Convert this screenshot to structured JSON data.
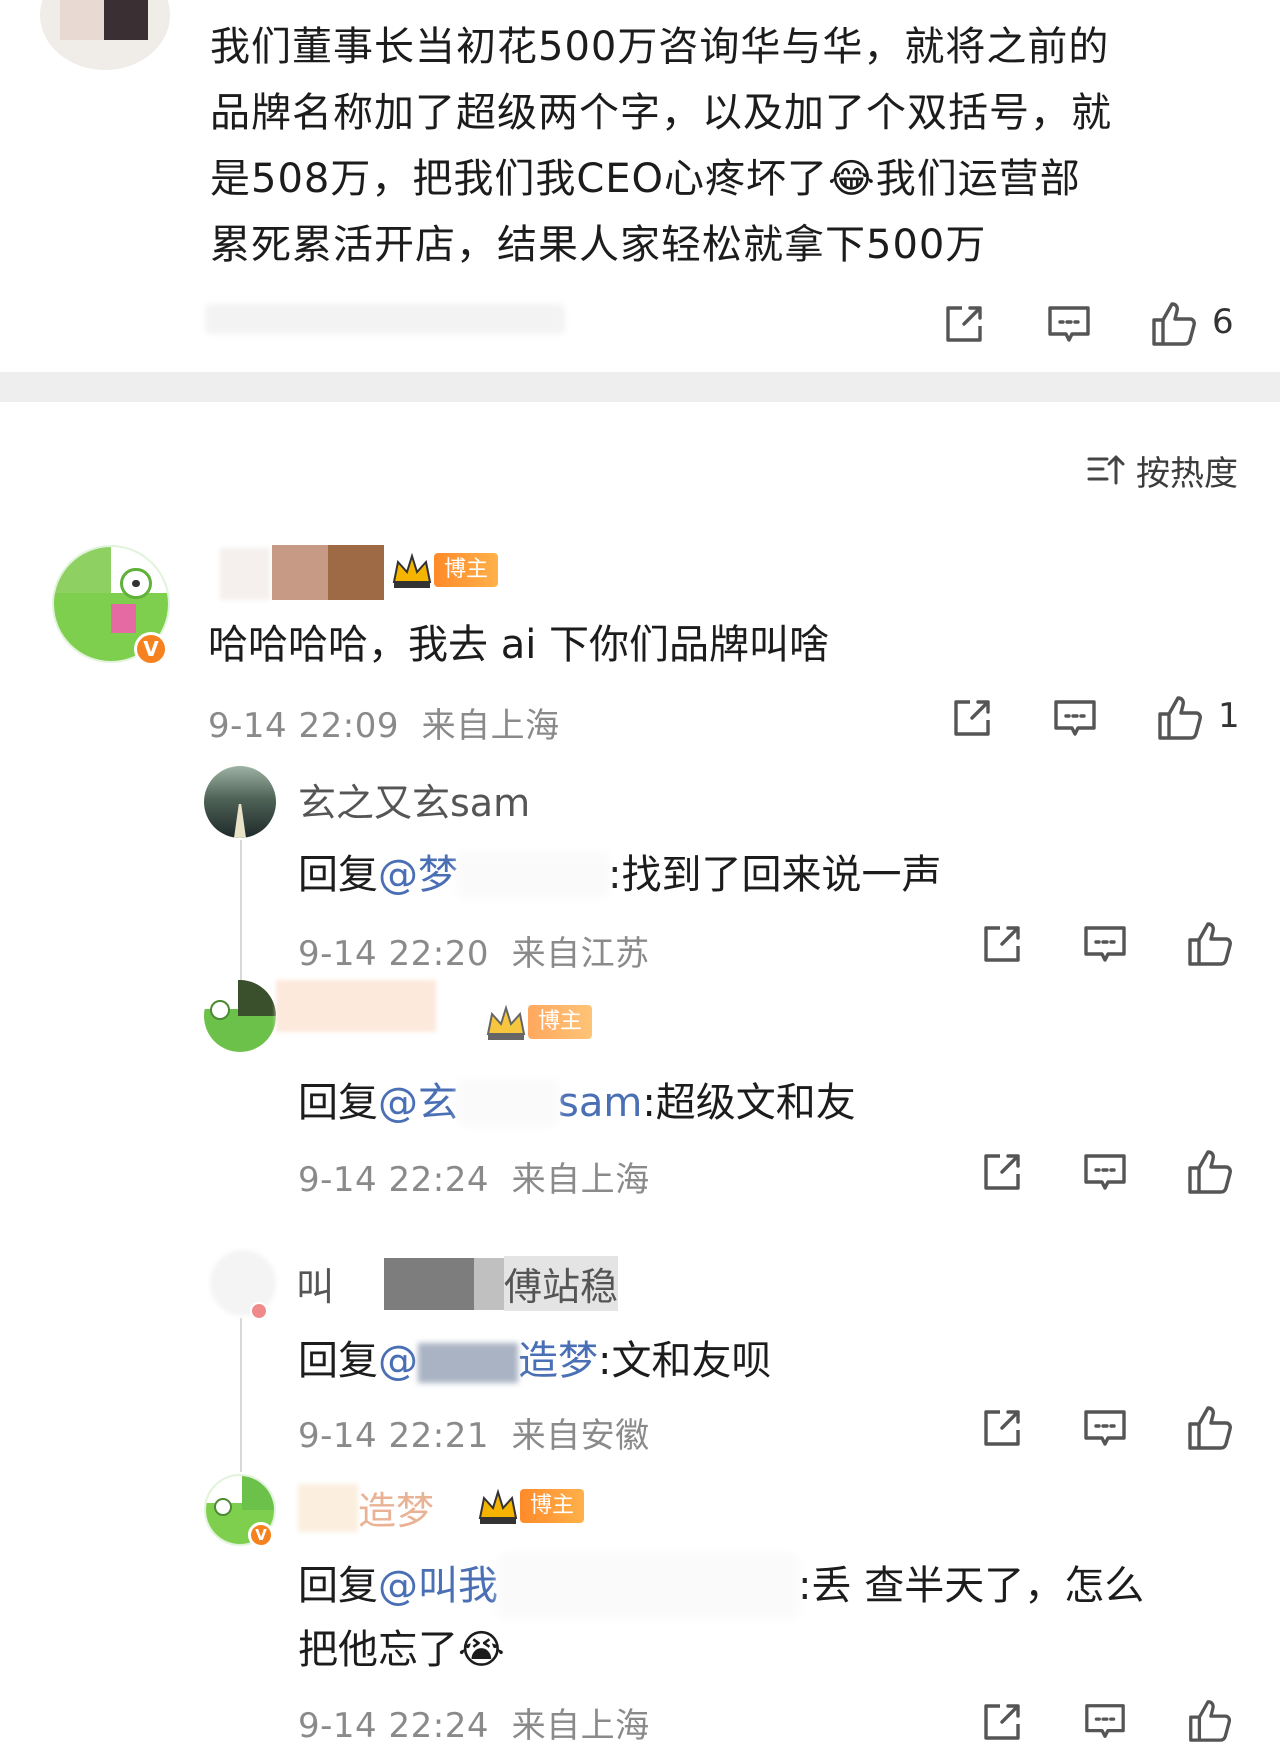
{
  "post": {
    "text": "我们董事长当初花500万咨询华与华，就将之前的品牌名称加了超级两个字，以及加了个双括号，就是508万，把我们我CEO心疼坏了😂我们运营部累死累活开店，结果人家轻松就拿下500万",
    "line1": "我们董事长当初花500万咨询华与华，就将之前的",
    "line2": "品牌名称加了超级两个字，以及加了个双括号，就",
    "line3_a": "是508万，把我们我CEO心疼坏了",
    "line3_emoji": "😂",
    "line3_b": "我们运营部",
    "line4": "累死累活开店，结果人家轻松就拿下500万",
    "likes": "6"
  },
  "sort": {
    "label": "按热度",
    "icon": "sort-hot-icon"
  },
  "comment": {
    "text": "哈哈哈哈，我去 ai 下你们品牌叫啥",
    "badge": "博主",
    "verified_mark": "V",
    "time": "9-14 22:09",
    "location": "来自上海",
    "likes": "1"
  },
  "replies": [
    {
      "name": "玄之又玄sam",
      "prefix": "回复",
      "mention": "@梦",
      "text": ":找到了回来说一声",
      "time": "9-14 22:20",
      "location": "来自江苏"
    },
    {
      "name": "",
      "badge": "博主",
      "prefix": "回复",
      "mention": "@玄",
      "mention_tail": "sam",
      "text": ":超级文和友",
      "time": "9-14 22:24",
      "location": "来自上海"
    },
    {
      "name_a": "叫",
      "name_b": "傅站稳",
      "prefix": "回复",
      "mention": "@",
      "mention_tail": "造梦",
      "text": ":文和友呗",
      "time": "9-14 22:21",
      "location": "来自安徽"
    },
    {
      "name": "造梦",
      "badge": "博主",
      "verified_mark": "V",
      "prefix": "回复",
      "mention": "@叫我",
      "text_a": ":丢 查半天了，怎么",
      "text_b": "把他忘了",
      "emoji": "😭",
      "time": "9-14 22:24",
      "location": "来自上海"
    }
  ],
  "colors": {
    "accent": "#f5821f",
    "link": "#4a6fb5",
    "meta": "#8a8a8a",
    "divider": "#eeeeef"
  }
}
